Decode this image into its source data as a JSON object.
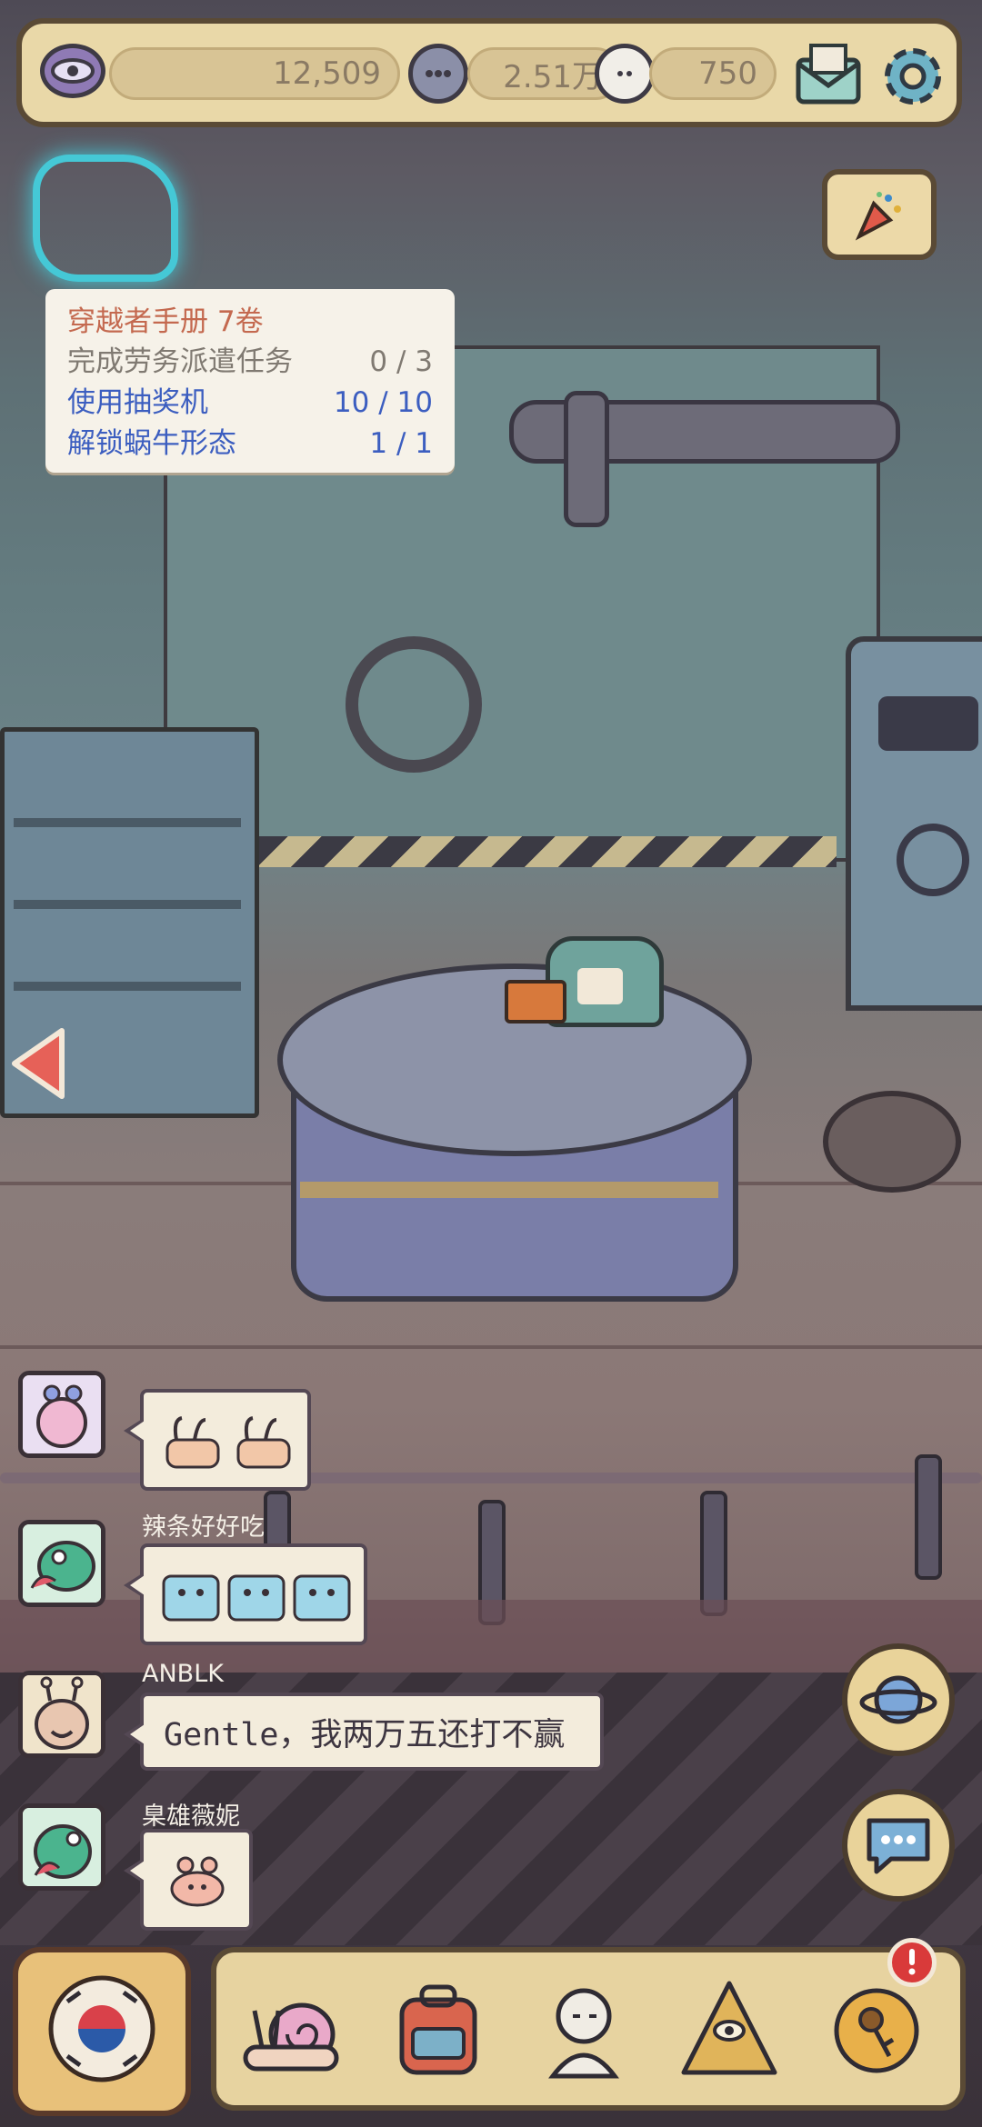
{
  "currencies": {
    "eyes": "12,509",
    "chat_bubbles": "2.51万",
    "ghost_bubbles": "750"
  },
  "task_panel": {
    "title": "穿越者手册  7卷",
    "tasks": [
      {
        "label": "完成劳务派遣任务",
        "progress": "0 / 3",
        "state": "pending"
      },
      {
        "label": "使用抽奖机",
        "progress": "10 / 10",
        "state": "done"
      },
      {
        "label": "解锁蜗牛形态",
        "progress": "1 / 1",
        "state": "done"
      }
    ]
  },
  "chat": {
    "messages": [
      {
        "name": "",
        "text": "",
        "emoji": "snail-duo"
      },
      {
        "name": "辣条好好吃",
        "text": "",
        "emoji": "ghost-trio"
      },
      {
        "name": "ANBLK",
        "text": "Gentle，我两万五还打不赢",
        "emoji": ""
      },
      {
        "name": "臬雄薇妮",
        "text": "",
        "emoji": "crab"
      }
    ]
  },
  "icons": {
    "top": [
      "eye-icon",
      "chat-bubble-icon",
      "ghost-bubble-icon",
      "mail-icon",
      "gear-icon"
    ],
    "nav": [
      "snail-icon",
      "backpack-icon",
      "statue-icon",
      "pyramid-eye-icon",
      "key-icon"
    ],
    "side": [
      "party-popper-icon",
      "planet-icon",
      "chat-icon",
      "left-arrow-icon"
    ]
  },
  "colors": {
    "accent_gold": "#e9d8a8",
    "task_done": "#3c5ec0",
    "task_title": "#c4694f",
    "notification_red": "#d93a3a"
  }
}
